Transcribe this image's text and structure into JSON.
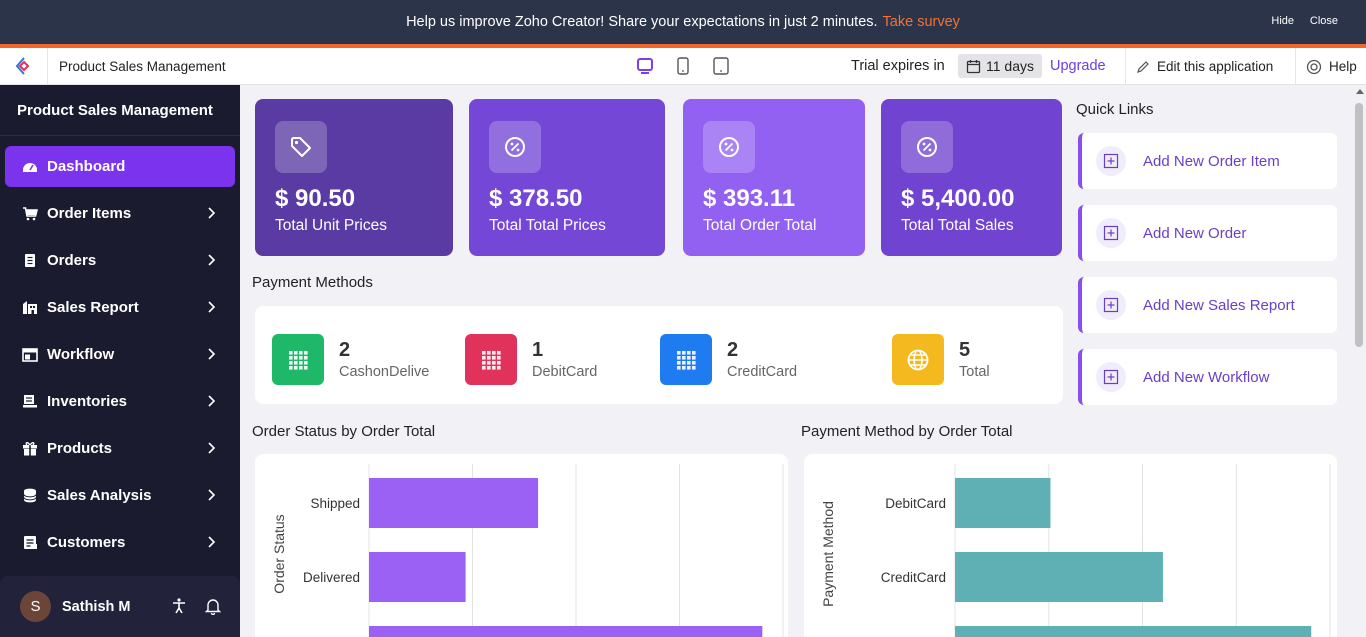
{
  "banner": {
    "message": "Help us improve Zoho Creator! Share your expectations in just 2 minutes.",
    "link": "Take survey",
    "hide": "Hide",
    "close": "Close"
  },
  "topbar": {
    "app_title": "Product Sales Management",
    "trial_text": "Trial expires in",
    "trial_days": "11 days",
    "upgrade": "Upgrade",
    "edit_app": "Edit this application",
    "help": "Help"
  },
  "sidebar": {
    "title": "Product Sales Management",
    "items": [
      {
        "label": "Dashboard",
        "icon": "dashboard-icon",
        "active": true
      },
      {
        "label": "Order Items",
        "icon": "cart-icon"
      },
      {
        "label": "Orders",
        "icon": "document-icon"
      },
      {
        "label": "Sales Report",
        "icon": "building-icon"
      },
      {
        "label": "Workflow",
        "icon": "workflow-icon"
      },
      {
        "label": "Inventories",
        "icon": "inventory-icon"
      },
      {
        "label": "Products",
        "icon": "gift-icon"
      },
      {
        "label": "Sales Analysis",
        "icon": "database-icon"
      },
      {
        "label": "Customers",
        "icon": "customers-icon"
      }
    ],
    "user": {
      "initial": "S",
      "name": "Sathish M"
    }
  },
  "stats": [
    {
      "value": "$ 90.50",
      "label": "Total Unit Prices",
      "color": "#5a3ba3",
      "icon": "tag-icon"
    },
    {
      "value": "$ 378.50",
      "label": "Total Total Prices",
      "color": "#7447d6",
      "icon": "percent-icon"
    },
    {
      "value": "$ 393.11",
      "label": "Total Order Total",
      "color": "#9261f2",
      "icon": "percent-icon"
    },
    {
      "value": "$ 5,400.00",
      "label": "Total Total Sales",
      "color": "#7043d0",
      "icon": "percent-icon"
    }
  ],
  "payment_methods": {
    "title": "Payment Methods",
    "items": [
      {
        "count": "2",
        "name": "CashonDelive",
        "color": "#1fb868",
        "icon": "grid-icon"
      },
      {
        "count": "1",
        "name": "DebitCard",
        "color": "#e0325b",
        "icon": "grid-icon"
      },
      {
        "count": "2",
        "name": "CreditCard",
        "color": "#1f7bf0",
        "icon": "grid-icon"
      },
      {
        "count": "5",
        "name": "Total",
        "color": "#f5b920",
        "icon": "globe-icon"
      }
    ]
  },
  "quick_links": {
    "title": "Quick Links",
    "items": [
      "Add New Order Item",
      "Add New Order",
      "Add New Sales Report",
      "Add New Workflow"
    ]
  },
  "chart_data": [
    {
      "type": "bar",
      "title": "Order Status by Order Total",
      "ylabel": "Order Status",
      "categories": [
        "Shipped",
        "Delivered"
      ],
      "values": [
        98,
        56
      ],
      "xlim": [
        0,
        240
      ],
      "color": "#9a61f4",
      "grid": true
    },
    {
      "type": "bar",
      "title": "Payment Method by Order Total",
      "ylabel": "Payment Method",
      "categories": [
        "DebitCard",
        "CreditCard"
      ],
      "values": [
        56,
        122
      ],
      "xlim": [
        0,
        220
      ],
      "color": "#5eb0b5",
      "grid": true
    }
  ]
}
